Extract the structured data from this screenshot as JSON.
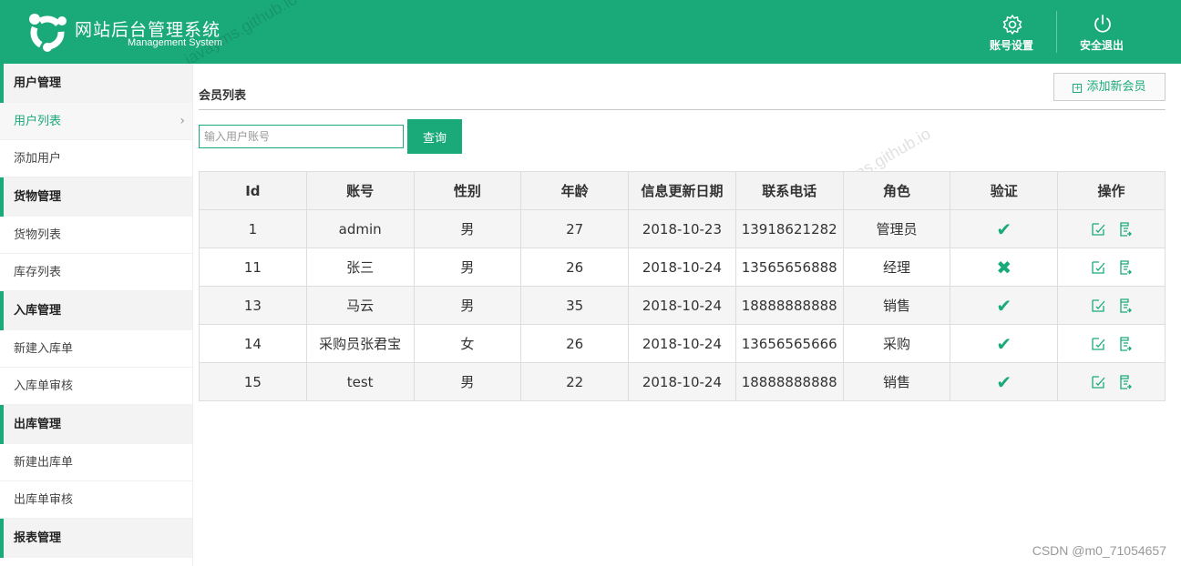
{
  "header": {
    "title": "网站后台管理系统",
    "subtitle": "Management System",
    "account_settings": "账号设置",
    "logout": "安全退出"
  },
  "watermark": "javayms.github.io",
  "sidebar": {
    "groups": [
      {
        "label": "用户管理",
        "items": [
          {
            "label": "用户列表",
            "active": true
          },
          {
            "label": "添加用户"
          }
        ]
      },
      {
        "label": "货物管理",
        "items": [
          {
            "label": "货物列表"
          },
          {
            "label": "库存列表"
          }
        ]
      },
      {
        "label": "入库管理",
        "items": [
          {
            "label": "新建入库单"
          },
          {
            "label": "入库单审核"
          }
        ]
      },
      {
        "label": "出库管理",
        "items": [
          {
            "label": "新建出库单"
          },
          {
            "label": "出库单审核"
          }
        ]
      },
      {
        "label": "报表管理",
        "items": []
      }
    ]
  },
  "main": {
    "title": "会员列表",
    "add_button": "添加新会员",
    "search_placeholder": "输入用户账号",
    "search_button": "查询",
    "columns": [
      "Id",
      "账号",
      "性别",
      "年龄",
      "信息更新日期",
      "联系电话",
      "角色",
      "验证",
      "操作"
    ],
    "rows": [
      {
        "id": "1",
        "account": "admin",
        "gender": "男",
        "age": "27",
        "date": "2018-10-23",
        "phone": "13918621282",
        "role": "管理员",
        "verified": true
      },
      {
        "id": "11",
        "account": "张三",
        "gender": "男",
        "age": "26",
        "date": "2018-10-24",
        "phone": "13565656888",
        "role": "经理",
        "verified": false
      },
      {
        "id": "13",
        "account": "马云",
        "gender": "男",
        "age": "35",
        "date": "2018-10-24",
        "phone": "18888888888",
        "role": "销售",
        "verified": true
      },
      {
        "id": "14",
        "account": "采购员张君宝",
        "gender": "女",
        "age": "26",
        "date": "2018-10-24",
        "phone": "13656565666",
        "role": "采购",
        "verified": true
      },
      {
        "id": "15",
        "account": "test",
        "gender": "男",
        "age": "22",
        "date": "2018-10-24",
        "phone": "18888888888",
        "role": "销售",
        "verified": true
      }
    ]
  },
  "footer": {
    "csdn": "CSDN @m0_71054657"
  },
  "colors": {
    "accent": "#1aaa7a"
  }
}
